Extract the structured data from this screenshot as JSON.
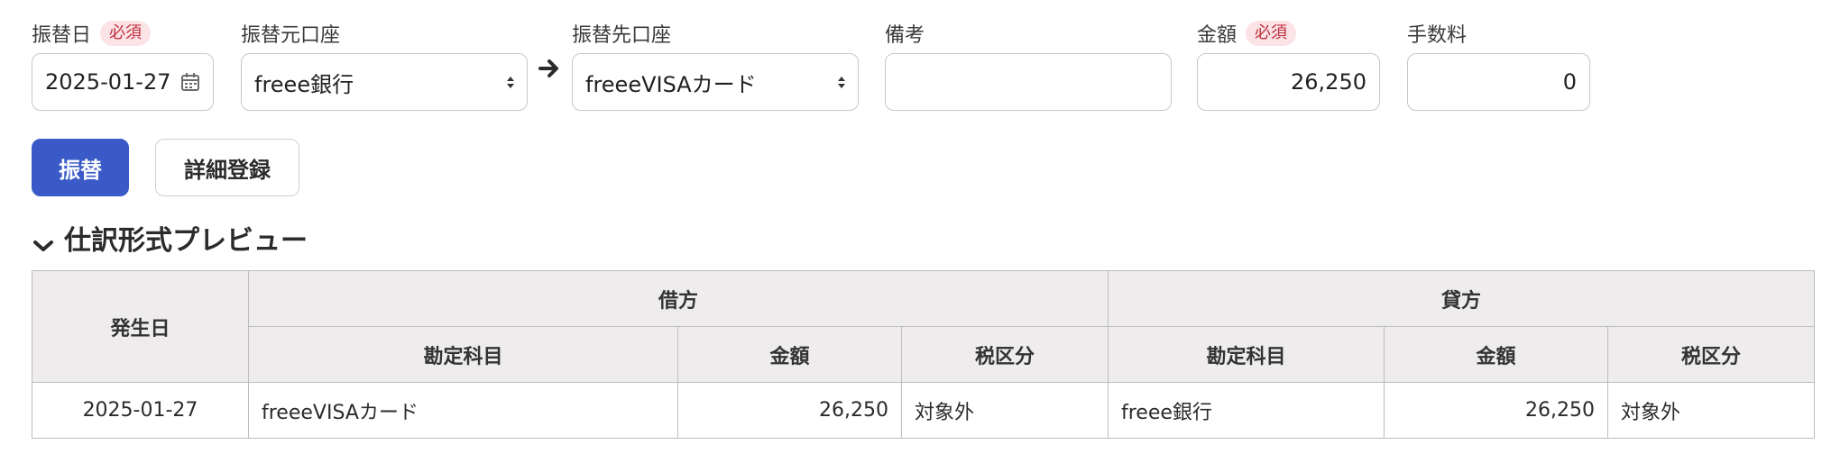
{
  "form": {
    "date_label": "振替日",
    "date_required": "必須",
    "date_value": "2025-01-27",
    "from_label": "振替元口座",
    "from_value": "freee銀行",
    "to_label": "振替先口座",
    "to_value": "freeeVISAカード",
    "memo_label": "備考",
    "memo_value": "",
    "amount_label": "金額",
    "amount_required": "必須",
    "amount_value": "26,250",
    "fee_label": "手数料",
    "fee_value": "0"
  },
  "actions": {
    "transfer_label": "振替",
    "detail_label": "詳細登録"
  },
  "preview": {
    "title": "仕訳形式プレビュー",
    "headers": {
      "date": "発生日",
      "debit": "借方",
      "credit": "貸方",
      "account": "勘定科目",
      "amount": "金額",
      "tax": "税区分"
    },
    "rows": [
      {
        "date": "2025-01-27",
        "debit_account": "freeeVISAカード",
        "debit_amount": "26,250",
        "debit_tax": "対象外",
        "credit_account": "freee銀行",
        "credit_amount": "26,250",
        "credit_tax": "対象外"
      }
    ]
  },
  "icons": {
    "calendar": "calendar-icon",
    "select": "select-arrows-icon",
    "arrow": "arrow-right-icon",
    "chevron": "chevron-down-icon"
  },
  "colors": {
    "primary": "#3a5bc7",
    "required_bg": "#fbe3e6",
    "required_text": "#c0303f",
    "table_header_bg": "#eeecec"
  }
}
